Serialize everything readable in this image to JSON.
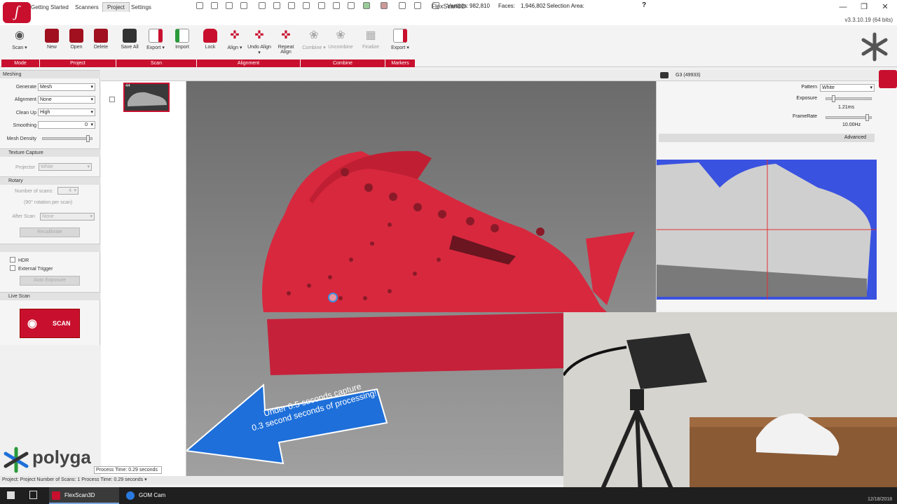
{
  "window": {
    "title": "FlexScan3D",
    "version": "v3.3.10.19  (64 bits)"
  },
  "tabs": [
    "Getting Started",
    "Scanners",
    "Project",
    "Settings"
  ],
  "ribbon": {
    "buttons": [
      "Scan ▾",
      "New",
      "Open",
      "Delete",
      "Save All",
      "Export ▾",
      "Import",
      "Lock",
      "Align ▾",
      "Undo Align ▾",
      "Repeat Align",
      "Combine ▾",
      "Uncombine",
      "Finalize",
      "Export ▾"
    ],
    "groups": [
      "Mode",
      "Project",
      "Scan",
      "Alignment",
      "Combine",
      "Markers"
    ]
  },
  "left_panel": {
    "section_meshing": "Meshing",
    "generate_label": "Generate",
    "generate_value": "Mesh",
    "alignment_label": "Alignment",
    "alignment_value": "None",
    "cleanup_label": "Clean Up",
    "cleanup_value": "High",
    "smoothing_label": "Smoothing",
    "smoothing_value": "0",
    "mesh_density_label": "Mesh Density",
    "section_texture": "Texture Capture",
    "projector_label": "Projector",
    "projector_value": "White",
    "section_rotary": "Rotary",
    "num_scans_label": "Number of scans:",
    "num_scans_value": "4",
    "rotation_note": "(90° rotation per scan)",
    "after_scan_label": "After Scan",
    "after_scan_value": "None",
    "recalibrate": "Recalibrate",
    "hdr": "HDR",
    "external_trigger": "External Trigger",
    "auto_exposure": "Auto Exposure",
    "section_live": "Live Scan",
    "scan_button": "SCAN"
  },
  "thumb": {
    "number": "44"
  },
  "viewport": {
    "vertices_label": "Vertices:",
    "vertices_value": "982,810",
    "faces_label": "Faces:",
    "faces_value": "1,946,802",
    "selection_label": "Selection Area:",
    "help": "?"
  },
  "camera": {
    "name": "G3 (49933)",
    "pattern_label": "Pattern",
    "pattern_value": "White",
    "exposure_label": "Exposure",
    "exposure_value": "1.21ms",
    "framerate_label": "FrameRate",
    "framerate_value": "10.00Hz",
    "advanced": "Advanced"
  },
  "overlay": {
    "line1": "Under 0.5 seconds capture",
    "line2": "0.3 second seconds of processing!!"
  },
  "status": {
    "text": "Project: Project   Number of Scans: 1   Process Time: 0.29 seconds ▾",
    "tip": "Process Time: 0.29 seconds"
  },
  "brand": {
    "name": "polyga"
  },
  "taskbar": {
    "app1": "FlexScan3D",
    "app2": "GOM Cam",
    "date": "12/18/2018"
  },
  "colors": {
    "accent": "#c8102e",
    "shoe": "#d8283e",
    "arrow": "#1e6fd9"
  }
}
